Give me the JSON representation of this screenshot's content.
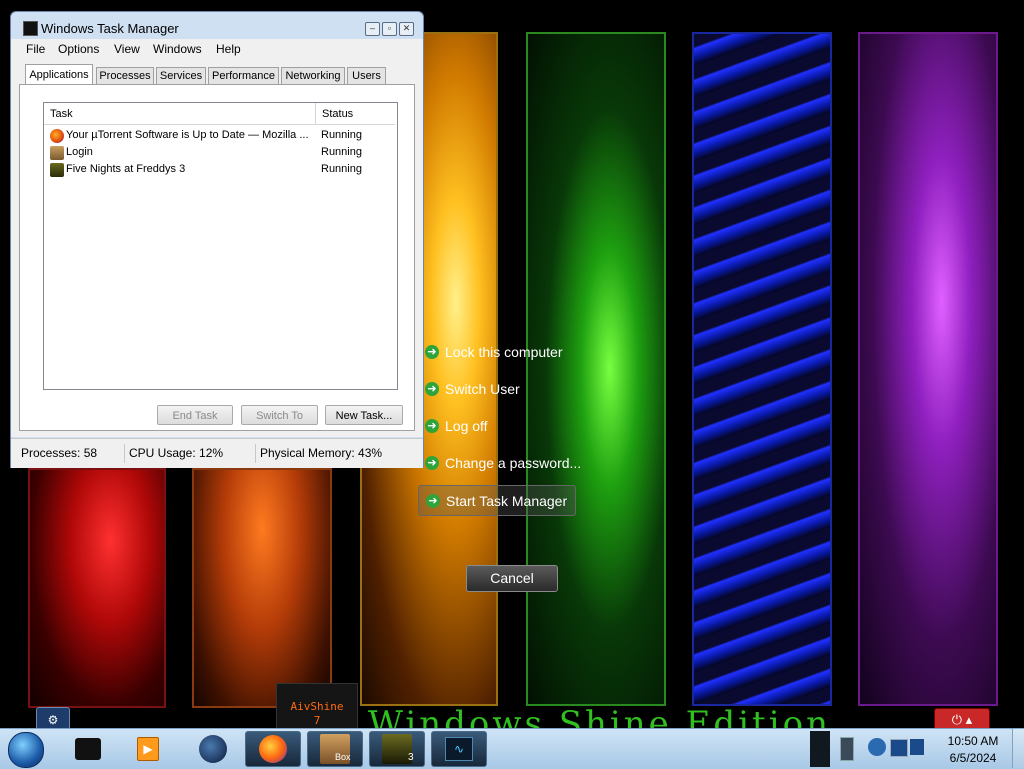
{
  "desktop": {
    "brand_text": "Windows Shine Edition",
    "aivshine_label": "AivShine",
    "aivshine_number": "7"
  },
  "security_options": {
    "items": [
      "Lock this computer",
      "Switch User",
      "Log off",
      "Change a password...",
      "Start Task Manager"
    ],
    "cancel_label": "Cancel"
  },
  "task_manager": {
    "title": "Windows Task Manager",
    "menu": [
      "File",
      "Options",
      "View",
      "Windows",
      "Help"
    ],
    "tabs": [
      "Applications",
      "Processes",
      "Services",
      "Performance",
      "Networking",
      "Users"
    ],
    "active_tab": "Applications",
    "columns": {
      "task": "Task",
      "status": "Status"
    },
    "rows": [
      {
        "task": "Your µTorrent Software is Up to Date — Mozilla ...",
        "status": "Running",
        "icon": "firefox-icon"
      },
      {
        "task": "Login",
        "status": "Running",
        "icon": "login-icon"
      },
      {
        "task": "Five Nights at Freddys 3",
        "status": "Running",
        "icon": "fnaf3-icon"
      }
    ],
    "buttons": {
      "end_task": "End Task",
      "switch_to": "Switch To",
      "new_task": "New Task..."
    },
    "status": {
      "processes": "Processes: 58",
      "cpu": "CPU Usage: 12%",
      "memory": "Physical Memory: 43%"
    }
  },
  "taskbar": {
    "items": [
      "start-orb",
      "black-box-app",
      "media-player",
      "globe-app",
      "firefox",
      "box-app",
      "fnaf3",
      "task-manager"
    ],
    "box_label": "Box",
    "fnaf_badge": "3",
    "clock_time": "10:50 AM",
    "clock_date": "6/5/2024"
  }
}
